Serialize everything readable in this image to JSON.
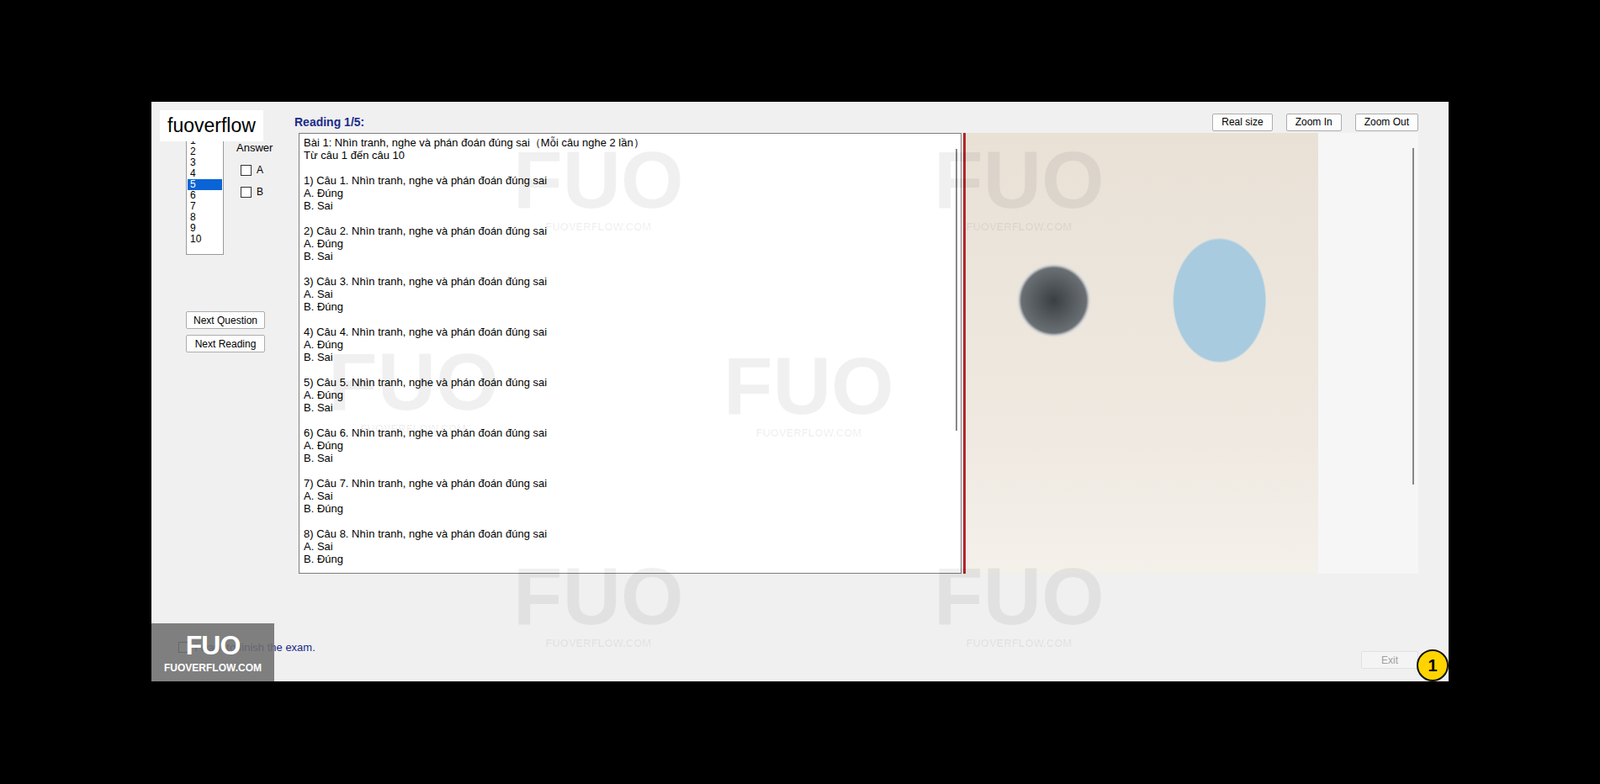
{
  "overlay_label": "fuoverflow",
  "question_list": {
    "items": [
      {
        "label": "1",
        "selected": false
      },
      {
        "label": "2",
        "selected": false
      },
      {
        "label": "3",
        "selected": false
      },
      {
        "label": "4",
        "selected": false
      },
      {
        "label": "5",
        "selected": true
      },
      {
        "label": "6",
        "selected": false
      },
      {
        "label": "7",
        "selected": false
      },
      {
        "label": "8",
        "selected": false
      },
      {
        "label": "9",
        "selected": false
      },
      {
        "label": "10",
        "selected": false
      }
    ]
  },
  "answer": {
    "title": "Answer",
    "options": [
      {
        "label": "A",
        "checked": false
      },
      {
        "label": "B",
        "checked": false
      }
    ]
  },
  "nav_buttons": [
    "Next Question",
    "Next Reading"
  ],
  "reading_title": "Reading 1/5:",
  "toolbar_buttons": [
    "Real size",
    "Zoom In",
    "Zoom Out"
  ],
  "passage": {
    "intro": [
      "Bài 1: Nhìn tranh, nghe và phán đoán đúng sai（Mỗi câu nghe 2 lần）",
      "Từ câu 1 đến câu 10"
    ],
    "questions": [
      {
        "title": "1) Câu 1. Nhìn tranh, nghe và phán đoán đúng sai",
        "options": [
          "A. Đúng",
          "B. Sai"
        ]
      },
      {
        "title": "2) Câu 2. Nhìn tranh, nghe và phán đoán đúng sai",
        "options": [
          "A. Đúng",
          "B. Sai"
        ]
      },
      {
        "title": "3) Câu 3. Nhìn tranh, nghe và phán đoán đúng sai",
        "options": [
          "A. Sai",
          "B. Đúng"
        ]
      },
      {
        "title": "4) Câu 4. Nhìn tranh, nghe và phán đoán đúng sai",
        "options": [
          "A. Đúng",
          "B. Sai"
        ]
      },
      {
        "title": "5) Câu 5. Nhìn tranh, nghe và phán đoán đúng sai",
        "options": [
          "A. Đúng",
          "B. Sai"
        ]
      },
      {
        "title": "6) Câu 6. Nhìn tranh, nghe và phán đoán đúng sai",
        "options": [
          "A. Đúng",
          "B. Sai"
        ]
      },
      {
        "title": "7) Câu 7. Nhìn tranh, nghe và phán đoán đúng sai",
        "options": [
          "A. Sai",
          "B. Đúng"
        ]
      },
      {
        "title": "8) Câu 8. Nhìn tranh, nghe và phán đoán đúng sai",
        "options": [
          "A. Sai",
          "B. Đúng"
        ]
      }
    ]
  },
  "finish": {
    "label": "I want to finish the exam.",
    "checked": false
  },
  "exit": {
    "label": "Exit",
    "disabled": true
  },
  "badge": "1",
  "logo": {
    "mark": "FUO",
    "caption": "FUOVERFLOW.COM"
  },
  "watermark": {
    "mark": "FUO",
    "caption": "FUOVERFLOW.COM"
  }
}
